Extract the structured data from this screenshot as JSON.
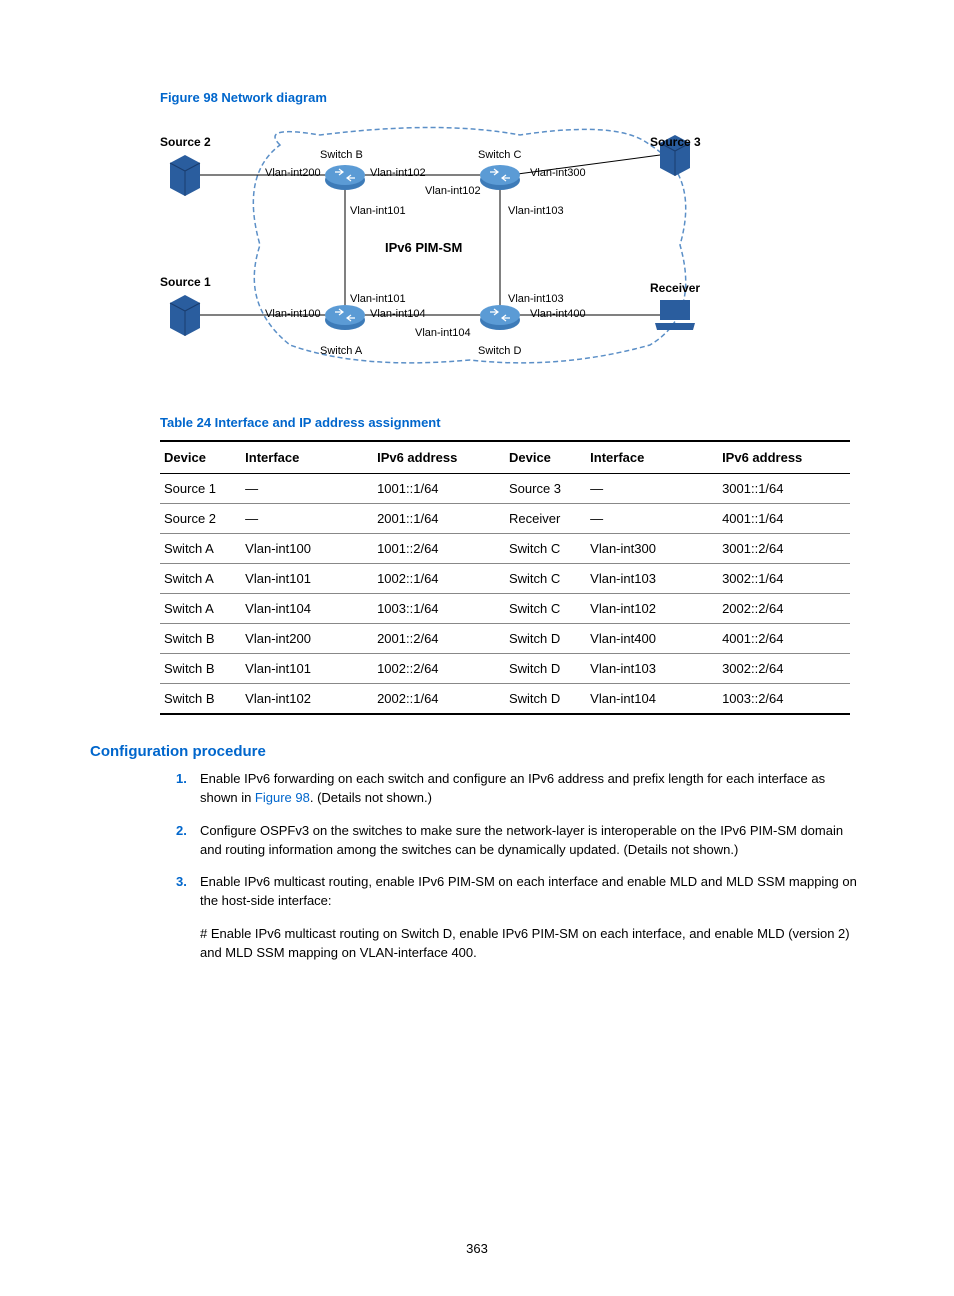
{
  "figure": {
    "caption": "Figure 98 Network diagram",
    "nodes": {
      "source1": "Source 1",
      "source2": "Source 2",
      "source3": "Source 3",
      "receiver": "Receiver",
      "switchA": "Switch A",
      "switchB": "Switch B",
      "switchC": "Switch C",
      "switchD": "Switch D",
      "center": "IPv6 PIM-SM"
    },
    "ifaces": {
      "b_200": "Vlan-int200",
      "b_102": "Vlan-int102",
      "b_101": "Vlan-int101",
      "c_102": "Vlan-int102",
      "c_300": "Vlan-int300",
      "c_103": "Vlan-int103",
      "a_100": "Vlan-int100",
      "a_101": "Vlan-int101",
      "a_104": "Vlan-int104",
      "a_104b": "Vlan-int104",
      "d_103": "Vlan-int103",
      "d_400": "Vlan-int400"
    }
  },
  "table": {
    "caption": "Table 24 Interface and IP address assignment",
    "headers": {
      "device": "Device",
      "interface": "Interface",
      "addr": "IPv6 address"
    },
    "rows": [
      {
        "d1": "Source 1",
        "i1": "—",
        "a1": "1001::1/64",
        "d2": "Source 3",
        "i2": "—",
        "a2": "3001::1/64"
      },
      {
        "d1": "Source 2",
        "i1": "—",
        "a1": "2001::1/64",
        "d2": "Receiver",
        "i2": "—",
        "a2": "4001::1/64"
      },
      {
        "d1": "Switch A",
        "i1": "Vlan-int100",
        "a1": "1001::2/64",
        "d2": "Switch C",
        "i2": "Vlan-int300",
        "a2": "3001::2/64"
      },
      {
        "d1": "Switch A",
        "i1": "Vlan-int101",
        "a1": "1002::1/64",
        "d2": "Switch C",
        "i2": "Vlan-int103",
        "a2": "3002::1/64"
      },
      {
        "d1": "Switch A",
        "i1": "Vlan-int104",
        "a1": "1003::1/64",
        "d2": "Switch C",
        "i2": "Vlan-int102",
        "a2": "2002::2/64"
      },
      {
        "d1": "Switch B",
        "i1": "Vlan-int200",
        "a1": "2001::2/64",
        "d2": "Switch D",
        "i2": "Vlan-int400",
        "a2": "4001::2/64"
      },
      {
        "d1": "Switch B",
        "i1": "Vlan-int101",
        "a1": "1002::2/64",
        "d2": "Switch D",
        "i2": "Vlan-int103",
        "a2": "3002::2/64"
      },
      {
        "d1": "Switch B",
        "i1": "Vlan-int102",
        "a1": "2002::1/64",
        "d2": "Switch D",
        "i2": "Vlan-int104",
        "a2": "1003::2/64"
      }
    ]
  },
  "section_title": "Configuration procedure",
  "steps": {
    "s1a": "Enable IPv6 forwarding on each switch and configure an IPv6 address and prefix length for each interface as shown in ",
    "s1_ref": "Figure 98",
    "s1b": ". (Details not shown.)",
    "s2": "Configure OSPFv3 on the switches to make sure the network-layer is interoperable on the IPv6 PIM-SM domain and routing information among the switches can be dynamically updated. (Details not shown.)",
    "s3": "Enable IPv6 multicast routing, enable IPv6 PIM-SM on each interface and enable MLD and MLD SSM mapping on the host-side interface:"
  },
  "para": "# Enable IPv6 multicast routing on Switch D, enable IPv6 PIM-SM on each interface, and enable MLD (version 2) and MLD SSM mapping on VLAN-interface 400.",
  "page_number": "363"
}
